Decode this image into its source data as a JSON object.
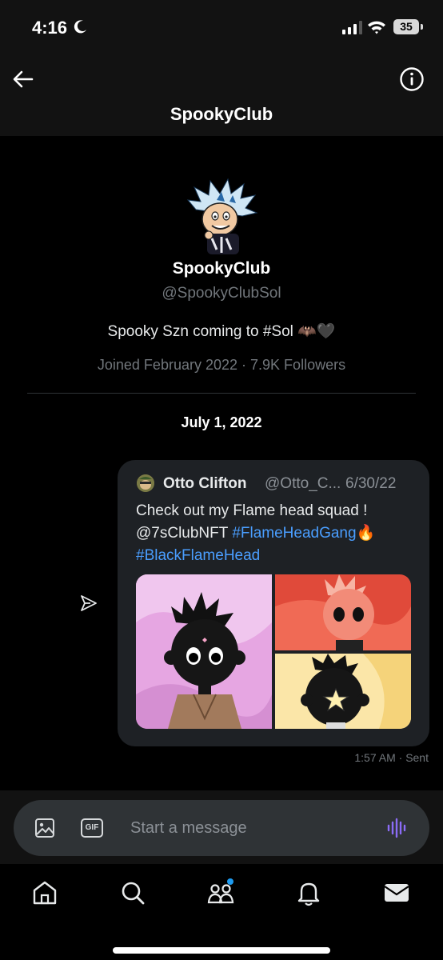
{
  "status_bar": {
    "time": "4:16",
    "battery": "35"
  },
  "header": {
    "title": "SpookyClub"
  },
  "profile": {
    "name": "SpookyClub",
    "handle": "@SpookyClubSol",
    "bio": "Spooky Szn coming to #Sol 🦇🖤",
    "joined": "Joined February 2022",
    "followers": "7.9K Followers"
  },
  "conversation": {
    "date": "July 1, 2022",
    "message": {
      "quote": {
        "name": "Otto Clifton",
        "handle": "@Otto_C...",
        "date": "6/30/22",
        "text_plain": "Check out my Flame head squad !",
        "mention": "@7sClubNFT",
        "hashtag1": "#FlameHeadGang",
        "fire": "🔥",
        "hashtag2": "#BlackFlameHead"
      },
      "time": "1:57 AM",
      "status": "Sent"
    }
  },
  "composer": {
    "placeholder": "Start a message"
  },
  "tabs": [
    "home",
    "search",
    "communities",
    "notifications",
    "messages"
  ],
  "colors": {
    "accent": "#1d9bf0",
    "link": "#4a9eff",
    "voice": "#8b6cf6"
  }
}
